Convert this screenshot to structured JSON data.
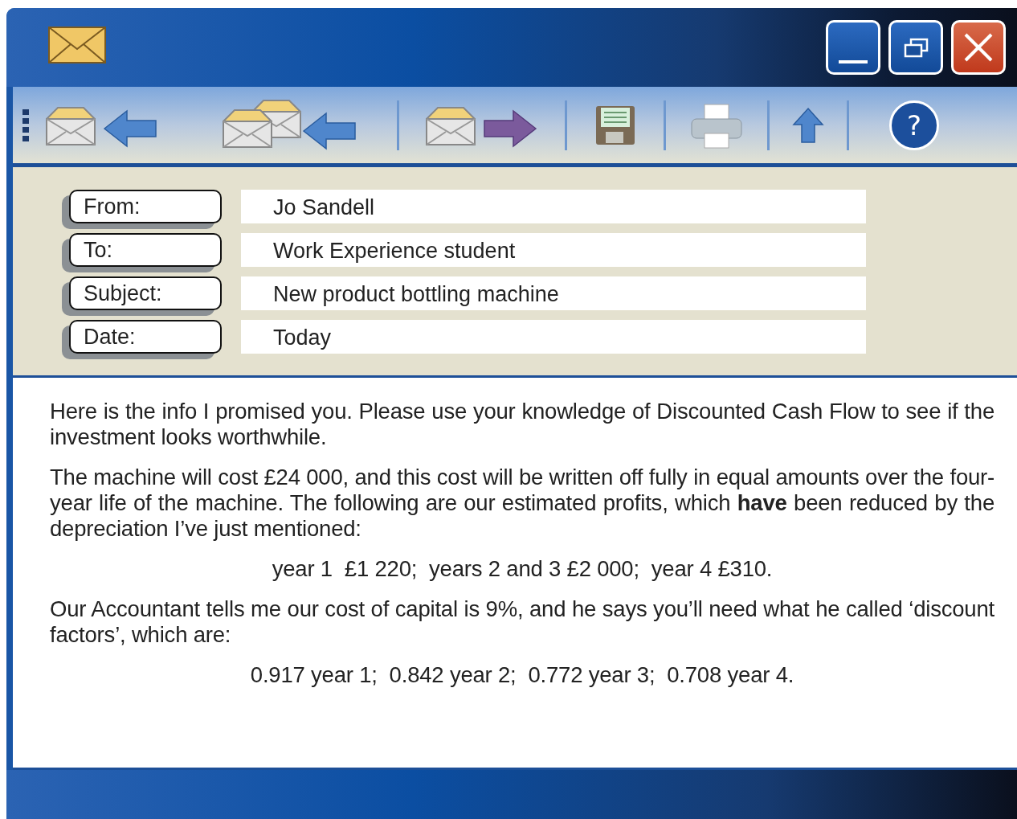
{
  "toolbar": [
    {
      "kind": "reply"
    },
    {
      "kind": "reply-all"
    },
    {
      "kind": "separator"
    },
    {
      "kind": "forward"
    },
    {
      "kind": "separator"
    },
    {
      "kind": "save"
    },
    {
      "kind": "separator"
    },
    {
      "kind": "print"
    },
    {
      "kind": "separator"
    },
    {
      "kind": "up"
    },
    {
      "kind": "separator"
    },
    {
      "kind": "help",
      "label": "?"
    }
  ],
  "header": [
    {
      "label": "From:",
      "value": "Jo Sandell"
    },
    {
      "label": "To:",
      "value": "Work Experience student"
    },
    {
      "label": "Subject:",
      "value": "New product bottling machine"
    },
    {
      "label": "Date:",
      "value": "Today"
    }
  ],
  "body": [
    {
      "kind": "paragraph",
      "text": "Here is the info I promised you. Please use your knowledge of Discounted Cash Flow to see if the investment looks worthwhile."
    },
    {
      "kind": "paragraph",
      "text": "The machine will cost £24 000, and this cost will be written off fully in equal amounts over the four-year life of the machine. The following are our estimated profits, which **have** been reduced by the depreciation I’ve just mentioned:"
    },
    {
      "kind": "centered",
      "text": "year 1  £1 220;  years 2 and 3 £2 000;  year 4 £310."
    },
    {
      "kind": "paragraph",
      "text": "Our Accountant tells me our cost of capital is 9%, and he says you’ll need what he called ‘discount factors’, which are:"
    },
    {
      "kind": "centered",
      "text": "0.917 year 1;  0.842 year 2;  0.772 year 3;  0.708 year 4."
    }
  ]
}
